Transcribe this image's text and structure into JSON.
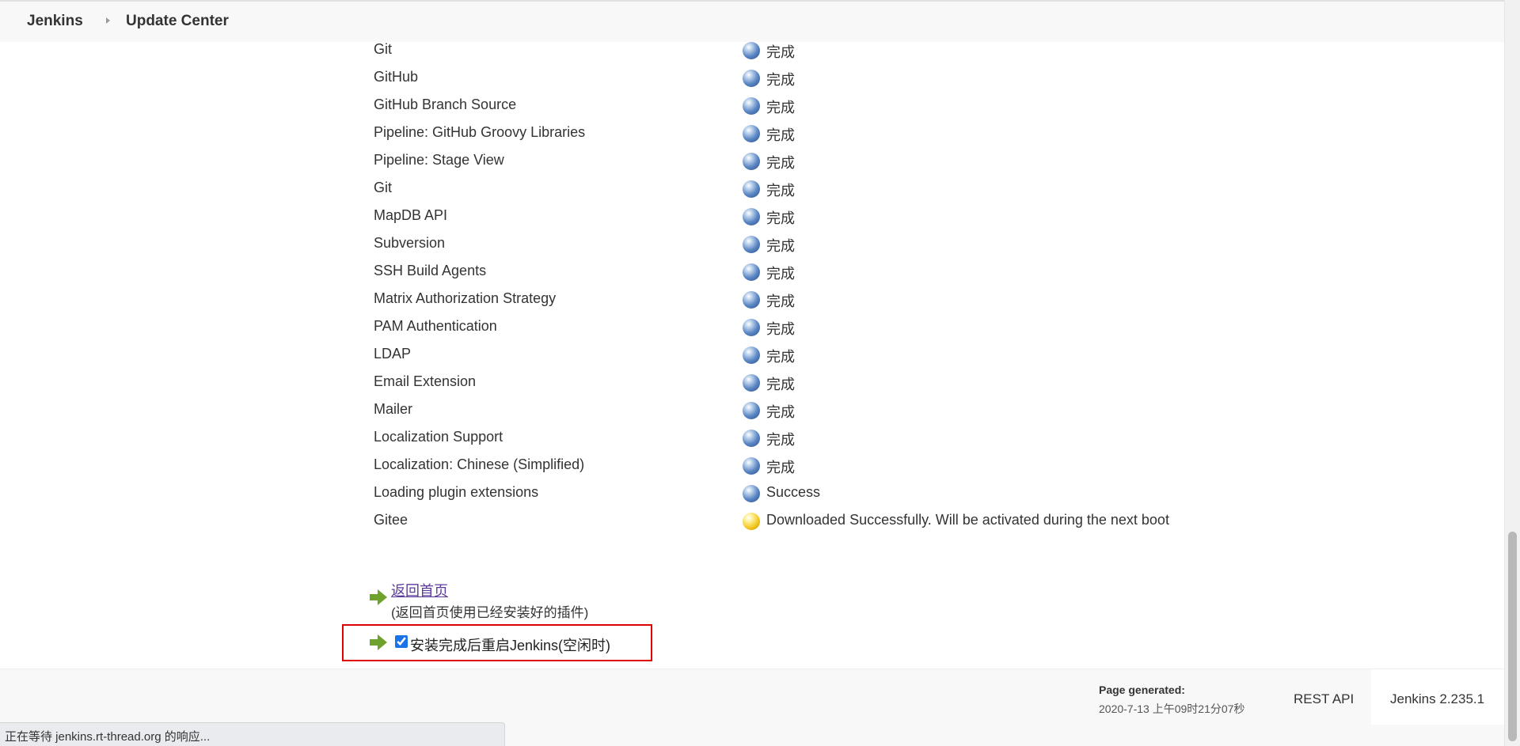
{
  "breadcrumb": {
    "home": "Jenkins",
    "current": "Update Center"
  },
  "plugins": [
    {
      "name": "Git",
      "status": "完成",
      "icon": "blue-ball-icon"
    },
    {
      "name": "GitHub",
      "status": "完成",
      "icon": "blue-ball-icon"
    },
    {
      "name": "GitHub Branch Source",
      "status": "完成",
      "icon": "blue-ball-icon"
    },
    {
      "name": "Pipeline: GitHub Groovy Libraries",
      "status": "完成",
      "icon": "blue-ball-icon"
    },
    {
      "name": "Pipeline: Stage View",
      "status": "完成",
      "icon": "blue-ball-icon"
    },
    {
      "name": "Git",
      "status": "完成",
      "icon": "blue-ball-icon"
    },
    {
      "name": "MapDB API",
      "status": "完成",
      "icon": "blue-ball-icon"
    },
    {
      "name": "Subversion",
      "status": "完成",
      "icon": "blue-ball-icon"
    },
    {
      "name": "SSH Build Agents",
      "status": "完成",
      "icon": "blue-ball-icon"
    },
    {
      "name": "Matrix Authorization Strategy",
      "status": "完成",
      "icon": "blue-ball-icon"
    },
    {
      "name": "PAM Authentication",
      "status": "完成",
      "icon": "blue-ball-icon"
    },
    {
      "name": "LDAP",
      "status": "完成",
      "icon": "blue-ball-icon"
    },
    {
      "name": "Email Extension",
      "status": "完成",
      "icon": "blue-ball-icon"
    },
    {
      "name": "Mailer",
      "status": "完成",
      "icon": "blue-ball-icon"
    },
    {
      "name": "Localization Support",
      "status": "完成",
      "icon": "blue-ball-icon"
    },
    {
      "name": "Localization: Chinese (Simplified)",
      "status": "完成",
      "icon": "blue-ball-icon"
    },
    {
      "name": "Loading plugin extensions",
      "status": "Success",
      "icon": "blue-ball-icon"
    },
    {
      "name": "Gitee",
      "status": "Downloaded Successfully. Will be activated during the next boot",
      "icon": "yellow-ball-icon"
    }
  ],
  "actions": {
    "back_link": "返回首页",
    "back_desc": "(返回首页使用已经安装好的插件)",
    "restart_label": "安装完成后重启Jenkins(空闲时)",
    "restart_checked": true
  },
  "footer": {
    "page_generated_label": "Page generated:",
    "page_generated_value": "2020-7-13 上午09时21分07秒",
    "rest_api": "REST API",
    "version": "Jenkins 2.235.1"
  },
  "statusbar": "正在等待 jenkins.rt-thread.org 的响应...",
  "colors": {
    "highlight_border": "#e00000",
    "arrow_green": "#6fa22d",
    "link_visited": "#5b3a9a"
  }
}
